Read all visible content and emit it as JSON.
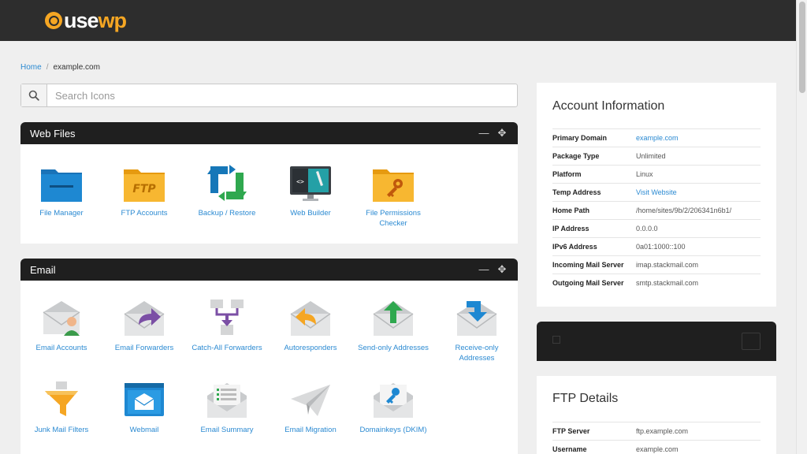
{
  "brand": {
    "logo_text_a": "use",
    "logo_text_b": "wp"
  },
  "breadcrumb": {
    "home": "Home",
    "separator": "/",
    "current": "example.com"
  },
  "search": {
    "placeholder": "Search Icons"
  },
  "web_files": {
    "title": "Web Files",
    "items": [
      {
        "label": "File Manager",
        "icon": "folder-blue-icon"
      },
      {
        "label": "FTP Accounts",
        "icon": "folder-ftp-icon"
      },
      {
        "label": "Backup / Restore",
        "icon": "backup-restore-icon"
      },
      {
        "label": "Web Builder",
        "icon": "web-builder-icon"
      },
      {
        "label": "File Permissions Checker",
        "icon": "folder-key-icon"
      }
    ]
  },
  "email": {
    "title": "Email",
    "items": [
      {
        "label": "Email Accounts",
        "icon": "email-user-icon"
      },
      {
        "label": "Email Forwarders",
        "icon": "email-forward-icon"
      },
      {
        "label": "Catch-All Forwarders",
        "icon": "catch-all-icon"
      },
      {
        "label": "Autoresponders",
        "icon": "email-reply-icon"
      },
      {
        "label": "Send-only Addresses",
        "icon": "email-send-icon"
      },
      {
        "label": "Receive-only Addresses",
        "icon": "email-receive-icon"
      },
      {
        "label": "Junk Mail Filters",
        "icon": "funnel-icon"
      },
      {
        "label": "Webmail",
        "icon": "webmail-icon"
      },
      {
        "label": "Email Summary",
        "icon": "email-summary-icon"
      },
      {
        "label": "Email Migration",
        "icon": "paper-plane-icon"
      },
      {
        "label": "Domainkeys (DKIM)",
        "icon": "email-key-icon"
      }
    ]
  },
  "account_info": {
    "title": "Account Information",
    "rows": [
      {
        "key": "Primary Domain",
        "value": "example.com",
        "link": true
      },
      {
        "key": "Package Type",
        "value": "Unlimited",
        "link": false
      },
      {
        "key": "Platform",
        "value": "Linux",
        "link": false
      },
      {
        "key": "Temp Address",
        "value": "Visit Website",
        "link": true
      },
      {
        "key": "Home Path",
        "value": "/home/sites/9b/2/206341n6b1/",
        "link": false
      },
      {
        "key": "IP Address",
        "value": "0.0.0.0",
        "link": false
      },
      {
        "key": "IPv6 Address",
        "value": "0a01:1000::100",
        "link": false
      },
      {
        "key": "Incoming Mail Server",
        "value": "imap.stackmail.com",
        "link": false
      },
      {
        "key": "Outgoing Mail Server",
        "value": "smtp.stackmail.com",
        "link": false
      }
    ]
  },
  "ftp_details": {
    "title": "FTP Details",
    "rows": [
      {
        "key": "FTP Server",
        "value": "ftp.example.com",
        "link": false
      },
      {
        "key": "Username",
        "value": "example.com",
        "link": false
      }
    ]
  },
  "colors": {
    "accent": "#f5a623",
    "link": "#2b8ad2",
    "header": "#2d2d2d",
    "panel_header": "#1f1f1f"
  }
}
